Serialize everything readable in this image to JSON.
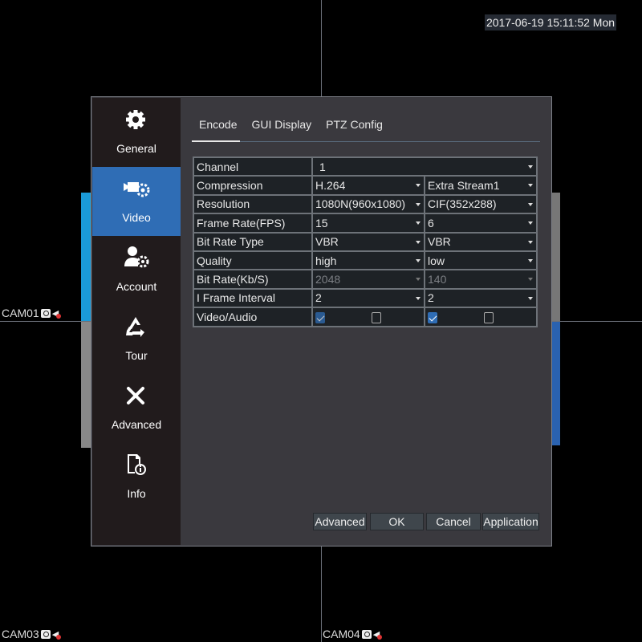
{
  "datetime": "2017-06-19 15:11:52 Mon",
  "cameras": [
    "CAM01",
    "CAM03",
    "CAM04"
  ],
  "sidebar": {
    "items": [
      {
        "label": "General",
        "icon": "gear-icon"
      },
      {
        "label": "Video",
        "icon": "video-settings-icon",
        "active": true
      },
      {
        "label": "Account",
        "icon": "user-settings-icon"
      },
      {
        "label": "Tour",
        "icon": "recycle-icon"
      },
      {
        "label": "Advanced",
        "icon": "tools-icon"
      },
      {
        "label": "Info",
        "icon": "info-document-icon"
      }
    ]
  },
  "tabs": [
    "Encode",
    "GUI Display",
    "PTZ Config"
  ],
  "selected_tab": "Encode",
  "table": {
    "channel": {
      "label": "Channel",
      "value": "1"
    },
    "rows": [
      {
        "label": "Compression",
        "main": "H.264",
        "extra": "Extra Stream1"
      },
      {
        "label": "Resolution",
        "main": "1080N(960x1080)",
        "extra": "CIF(352x288)"
      },
      {
        "label": "Frame Rate(FPS)",
        "main": "15",
        "extra": "6"
      },
      {
        "label": "Bit Rate Type",
        "main": "VBR",
        "extra": "VBR"
      },
      {
        "label": "Quality",
        "main": "high",
        "extra": "low"
      },
      {
        "label": "Bit Rate(Kb/S)",
        "main": "2048",
        "extra": "140",
        "disabled": true
      },
      {
        "label": "I Frame Interval",
        "main": "2",
        "extra": "2"
      }
    ],
    "video_audio": {
      "label": "Video/Audio",
      "main_video": true,
      "main_audio": false,
      "extra_video": true,
      "extra_audio": false
    }
  },
  "buttons": {
    "advanced": "Advanced",
    "ok": "OK",
    "cancel": "Cancel",
    "application": "Application"
  }
}
